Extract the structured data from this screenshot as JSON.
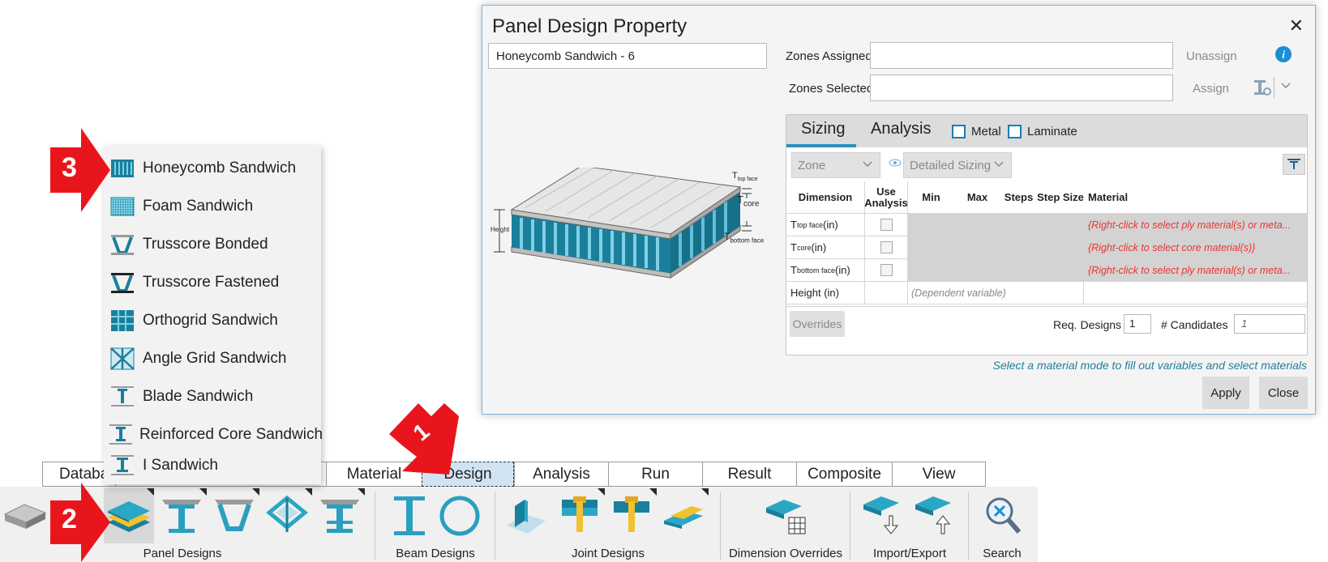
{
  "dialog": {
    "title": "Panel Design Property",
    "close_glyph": "✕",
    "name_value": "Honeycomb Sandwich - 6",
    "zones_assigned_label": "Zones Assigned:",
    "zones_selected_label": "Zones Selected:",
    "zones_assigned_value": "",
    "zones_selected_value": "",
    "unassign_label": "Unassign",
    "assign_label": "Assign",
    "info_glyph": "i",
    "tabs": [
      {
        "label": "Sizing"
      },
      {
        "label": "Analysis"
      }
    ],
    "material_modes": [
      {
        "label": "Metal"
      },
      {
        "label": "Laminate"
      }
    ],
    "zone_combo": "Zone",
    "sizing_combo": "Detailed Sizing",
    "image_labels": {
      "height": "Height",
      "t_top": "T",
      "t_top_sub": "top face",
      "t_core": "T",
      "t_core_sub": "core",
      "t_bottom": "T",
      "t_bottom_sub": "bottom face"
    },
    "grid": {
      "headers": [
        "Dimension",
        "Use Analysis",
        "Min",
        "Max",
        "Steps",
        "Step Size",
        "Material"
      ],
      "rows": [
        {
          "dim": "T",
          "sub": "top face",
          "unit": " (in)",
          "material": "{Right-click to select ply material(s) or meta..."
        },
        {
          "dim": "T",
          "sub": "core",
          "unit": " (in)",
          "material": "{Right-click to select core material(s)}"
        },
        {
          "dim": "T",
          "sub": "bottom face",
          "unit": " (in)",
          "material": "{Right-click to select ply material(s) or meta..."
        }
      ],
      "height_row": {
        "dim": "Height (in)",
        "note": "(Dependent variable)"
      }
    },
    "overrides_label": "Overrides",
    "req_designs_label": "Req. Designs",
    "req_designs_value": "1",
    "candidates_label": "# Candidates",
    "candidates_value": "1",
    "hint": "Select a material mode to fill out variables and select materials",
    "apply_label": "Apply",
    "close_label": "Close"
  },
  "menu": {
    "items": [
      {
        "label": "Honeycomb Sandwich",
        "icon": "honeycomb-icon"
      },
      {
        "label": "Foam Sandwich",
        "icon": "foam-icon"
      },
      {
        "label": "Trusscore Bonded",
        "icon": "trusscore-bonded-icon"
      },
      {
        "label": "Trusscore Fastened",
        "icon": "trusscore-fastened-icon"
      },
      {
        "label": "Orthogrid Sandwich",
        "icon": "orthogrid-icon"
      },
      {
        "label": "Angle Grid Sandwich",
        "icon": "angle-grid-icon"
      },
      {
        "label": "Blade Sandwich",
        "icon": "blade-icon"
      },
      {
        "label": "Reinforced Core Sandwich",
        "icon": "reinforced-core-icon"
      },
      {
        "label": "I Sandwich",
        "icon": "i-sandwich-icon"
      }
    ]
  },
  "ribbon": {
    "tabs": [
      {
        "label": "Databa"
      },
      {
        "label": ""
      },
      {
        "label": "Material"
      },
      {
        "label": "Design"
      },
      {
        "label": "Analysis"
      },
      {
        "label": "Run"
      },
      {
        "label": "Result"
      },
      {
        "label": "Composite"
      },
      {
        "label": "View"
      }
    ],
    "groups": {
      "panel_designs": "Panel Designs",
      "beam_designs": "Beam Designs",
      "joint_designs": "Joint Designs",
      "dimension_overrides": "Dimension Overrides",
      "import_export": "Import/Export",
      "search": "Search"
    }
  },
  "callouts": {
    "one": "1",
    "two": "2",
    "three": "3"
  },
  "colors": {
    "teal": "#1a7f9b",
    "accent_blue": "#1b8fd6",
    "callout_red": "#e8161c",
    "error_red": "#e33333"
  }
}
